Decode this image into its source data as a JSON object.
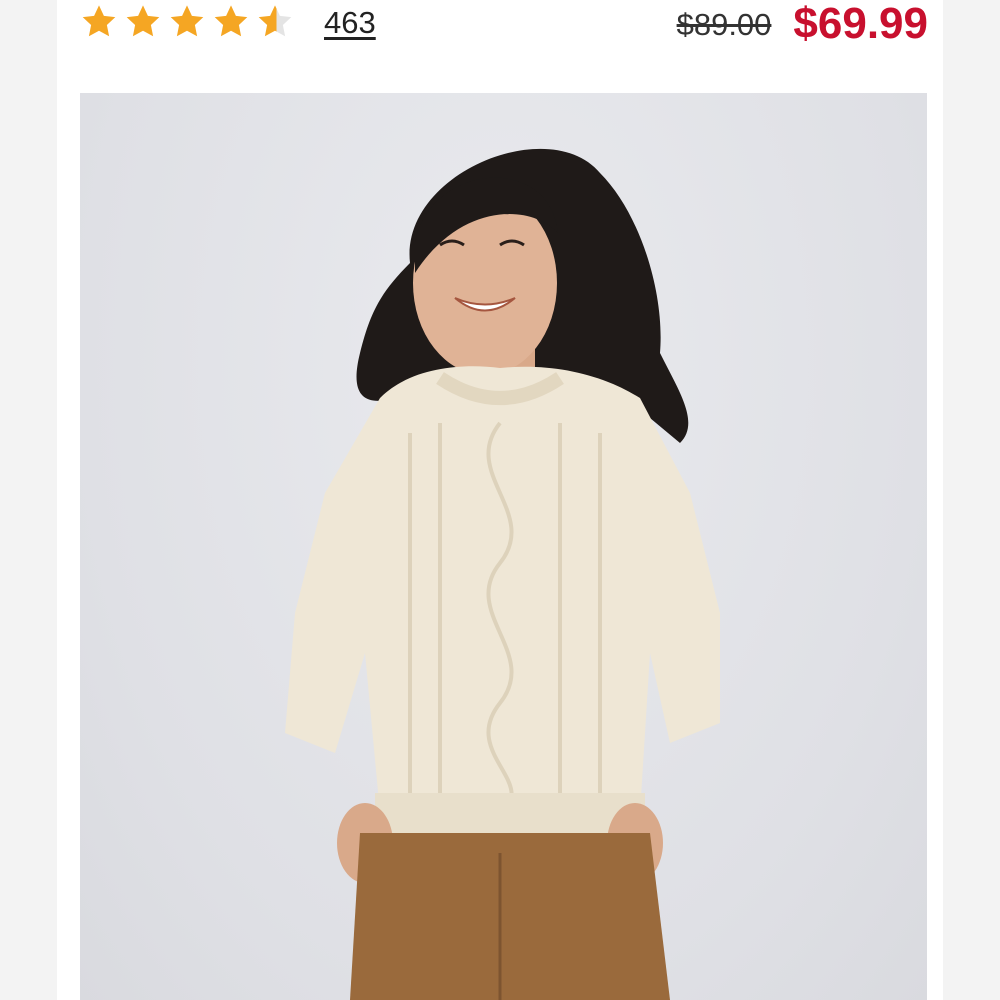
{
  "rating": {
    "average": 4.6,
    "max": 5,
    "star_color": "#f5a623",
    "icon": "star-icon",
    "review_count": "463"
  },
  "pricing": {
    "original": "$89.00",
    "sale": "$69.99",
    "sale_color": "#c8102e"
  },
  "product_image": {
    "icon": "product-photo"
  }
}
